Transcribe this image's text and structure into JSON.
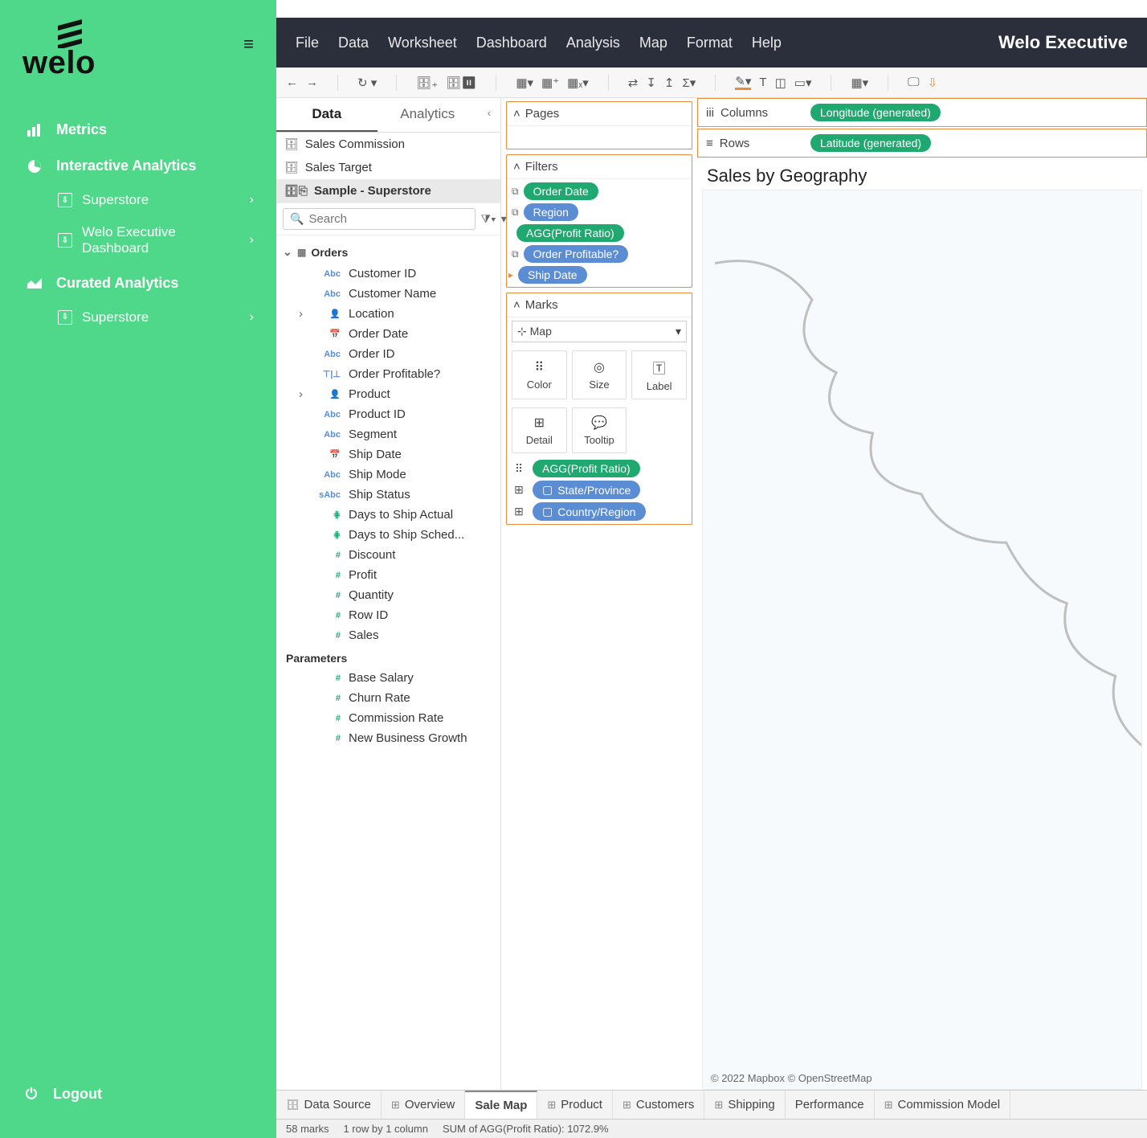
{
  "brand": {
    "name": "welo"
  },
  "sidebar": {
    "metrics": "Metrics",
    "interactive": "Interactive Analytics",
    "superstore": "Superstore",
    "welo_exec_line1": "Welo Executive",
    "welo_exec_line2": "Dashboard",
    "curated": "Curated Analytics",
    "superstore2": "Superstore",
    "logout": "Logout"
  },
  "menu": {
    "file": "File",
    "data": "Data",
    "worksheet": "Worksheet",
    "dashboard": "Dashboard",
    "analysis": "Analysis",
    "map": "Map",
    "format": "Format",
    "help": "Help"
  },
  "app_title": "Welo Executive",
  "data_panel": {
    "tab_data": "Data",
    "tab_analytics": "Analytics",
    "sources": [
      {
        "label": "Sales Commission",
        "icon": "db",
        "active": false
      },
      {
        "label": "Sales Target",
        "icon": "db",
        "active": false
      },
      {
        "label": "Sample - Superstore",
        "icon": "db-link",
        "active": true
      }
    ],
    "search_placeholder": "Search",
    "table": "Orders",
    "fields": [
      {
        "label": "Customer ID",
        "icon": "abc"
      },
      {
        "label": "Customer Name",
        "icon": "abc"
      },
      {
        "label": "Location",
        "icon": "geo",
        "expand": true
      },
      {
        "label": "Order Date",
        "icon": "date"
      },
      {
        "label": "Order ID",
        "icon": "abc"
      },
      {
        "label": "Order Profitable?",
        "icon": "tf"
      },
      {
        "label": "Product",
        "icon": "geo",
        "expand": true
      },
      {
        "label": "Product ID",
        "icon": "abc"
      },
      {
        "label": "Segment",
        "icon": "abc"
      },
      {
        "label": "Ship Date",
        "icon": "date"
      },
      {
        "label": "Ship Mode",
        "icon": "abc"
      },
      {
        "label": "Ship Status",
        "icon": "sabc"
      },
      {
        "label": "Days to Ship Actual",
        "icon": "calc"
      },
      {
        "label": "Days to Ship Sched...",
        "icon": "calc"
      },
      {
        "label": "Discount",
        "icon": "meas"
      },
      {
        "label": "Profit",
        "icon": "meas"
      },
      {
        "label": "Quantity",
        "icon": "meas"
      },
      {
        "label": "Row ID",
        "icon": "meas"
      },
      {
        "label": "Sales",
        "icon": "meas"
      }
    ],
    "parameters_label": "Parameters",
    "parameters": [
      {
        "label": "Base Salary"
      },
      {
        "label": "Churn Rate"
      },
      {
        "label": "Commission Rate"
      },
      {
        "label": "New Business Growth"
      }
    ]
  },
  "cards": {
    "pages": "Pages",
    "filters": "Filters",
    "filter_pills": [
      {
        "text": "Order Date",
        "color": "green",
        "lead": "stack"
      },
      {
        "text": "Region",
        "color": "blue",
        "lead": "stack"
      },
      {
        "text": "AGG(Profit Ratio)",
        "color": "green",
        "lead": ""
      },
      {
        "text": "Order Profitable?",
        "color": "blue",
        "lead": "stack"
      },
      {
        "text": "Ship Date",
        "color": "blue",
        "lead": "arrow"
      }
    ],
    "marks": "Marks",
    "mark_type": "Map",
    "mark_cells": {
      "color": "Color",
      "size": "Size",
      "label": "Label",
      "detail": "Detail",
      "tooltip": "Tooltip"
    },
    "mark_pills": [
      {
        "text": "AGG(Profit Ratio)",
        "color": "green",
        "lead": "color"
      },
      {
        "text": "State/Province",
        "color": "blue",
        "lead": "detail",
        "box": true
      },
      {
        "text": "Country/Region",
        "color": "blue",
        "lead": "detail",
        "box": true
      }
    ]
  },
  "shelves": {
    "columns": "Columns",
    "columns_pill": "Longitude (generated)",
    "rows": "Rows",
    "rows_pill": "Latitude (generated)"
  },
  "viz": {
    "title": "Sales by Geography",
    "attribution": "© 2022 Mapbox  © OpenStreetMap"
  },
  "tabs": [
    {
      "label": "Data Source",
      "icon": "ds"
    },
    {
      "label": "Overview",
      "icon": "grid"
    },
    {
      "label": "Sale Map",
      "icon": "",
      "active": true
    },
    {
      "label": "Product",
      "icon": "grid"
    },
    {
      "label": "Customers",
      "icon": "grid"
    },
    {
      "label": "Shipping",
      "icon": "grid"
    },
    {
      "label": "Performance",
      "icon": ""
    },
    {
      "label": "Commission Model",
      "icon": "grid"
    }
  ],
  "status": {
    "marks": "58 marks",
    "dims": "1 row by 1 column",
    "sum": "SUM of AGG(Profit Ratio): 1072.9%"
  }
}
